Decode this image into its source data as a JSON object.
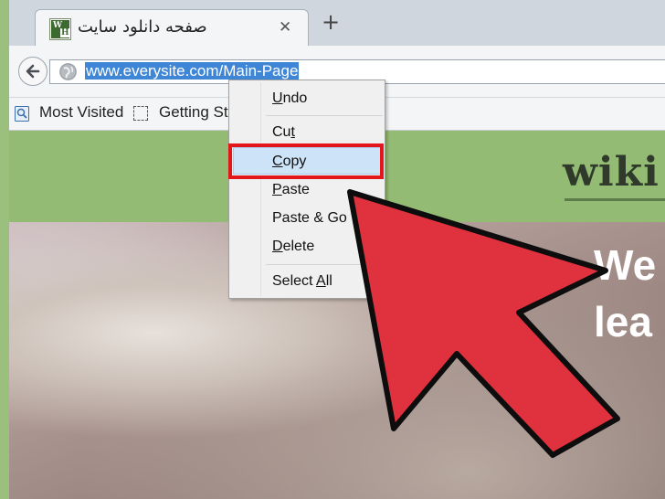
{
  "tab": {
    "title": "صفحه دانلود سایت",
    "close_glyph": "✕",
    "favicon_letters": [
      "W",
      "H"
    ]
  },
  "toolbar": {
    "new_tab_glyph": "+",
    "url": "www.everysite.com/Main-Page"
  },
  "bookmarks": [
    {
      "label": "Most Visited"
    },
    {
      "label": "Getting St"
    }
  ],
  "page": {
    "logo": "wiki",
    "hero_lines": [
      "We",
      "lea"
    ]
  },
  "context_menu": {
    "items": [
      {
        "pre": "",
        "u": "U",
        "post": "ndo"
      },
      {
        "pre": "Cu",
        "u": "t",
        "post": ""
      },
      {
        "pre": "",
        "u": "C",
        "post": "opy"
      },
      {
        "pre": "",
        "u": "P",
        "post": "aste"
      },
      {
        "pre": "Paste & Go",
        "u": "",
        "post": ""
      },
      {
        "pre": "",
        "u": "D",
        "post": "elete"
      },
      {
        "pre": "Select ",
        "u": "A",
        "post": "ll"
      }
    ],
    "highlighted": "Copy"
  },
  "colors": {
    "accent_red": "#e2161b",
    "arrow_fill": "#e0313e",
    "selection_blue": "#3f86d6",
    "page_green": "#94bb74"
  }
}
